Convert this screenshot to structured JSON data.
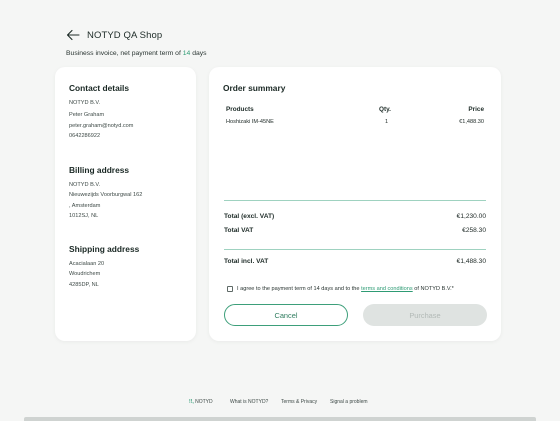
{
  "header": {
    "shop_name": "NOTYD QA Shop"
  },
  "subtitle": {
    "prefix": "Business invoice, net payment term of ",
    "term": "14",
    "suffix": " days"
  },
  "contact": {
    "title": "Contact details",
    "company": "NOTYD B.V.",
    "name": "Peter Graham",
    "email": "peter.graham@notyd.com",
    "phone": "0642286922"
  },
  "billing": {
    "title": "Billing address",
    "company": "NOTYD B.V.",
    "street": "Nieuwezijds Voorburgwal 162",
    "city": ", Amsterdam",
    "postcode": "1012SJ, NL"
  },
  "shipping": {
    "title": "Shipping address",
    "street": "Acacialaan 20",
    "city": "Woudrichem",
    "postcode": "4285DP, NL"
  },
  "order": {
    "title": "Order summary",
    "columns": {
      "product": "Products",
      "qty": "Qty.",
      "price": "Price"
    },
    "items": [
      {
        "product": "Hoshizaki IM-45NE",
        "qty": "1",
        "price": "€1,488.30"
      }
    ],
    "totals": {
      "excl_label": "Total (excl. VAT)",
      "excl_value": "€1,230.00",
      "vat_label": "Total VAT",
      "vat_value": "€258.30",
      "incl_label": "Total incl. VAT",
      "incl_value": "€1,488.30"
    }
  },
  "agreement": {
    "prefix": "I agree to the payment term of 14 days and to the ",
    "link": "terms and conditions",
    "suffix": " of NOTYD B.V.*",
    "checked": false
  },
  "buttons": {
    "cancel": "Cancel",
    "purchase": "Purchase"
  },
  "footer": {
    "logo_mark": "!!,",
    "logo_text": "NOTYD",
    "what_is": "What is NOTYD?",
    "terms": "Terms & Privacy",
    "signal": "Signal a problem"
  },
  "colors": {
    "accent": "#2e9b74",
    "background": "#f5f6f5",
    "disabled_button": "#dfe3e1"
  },
  "icons": {
    "back": "arrow-left-icon"
  }
}
